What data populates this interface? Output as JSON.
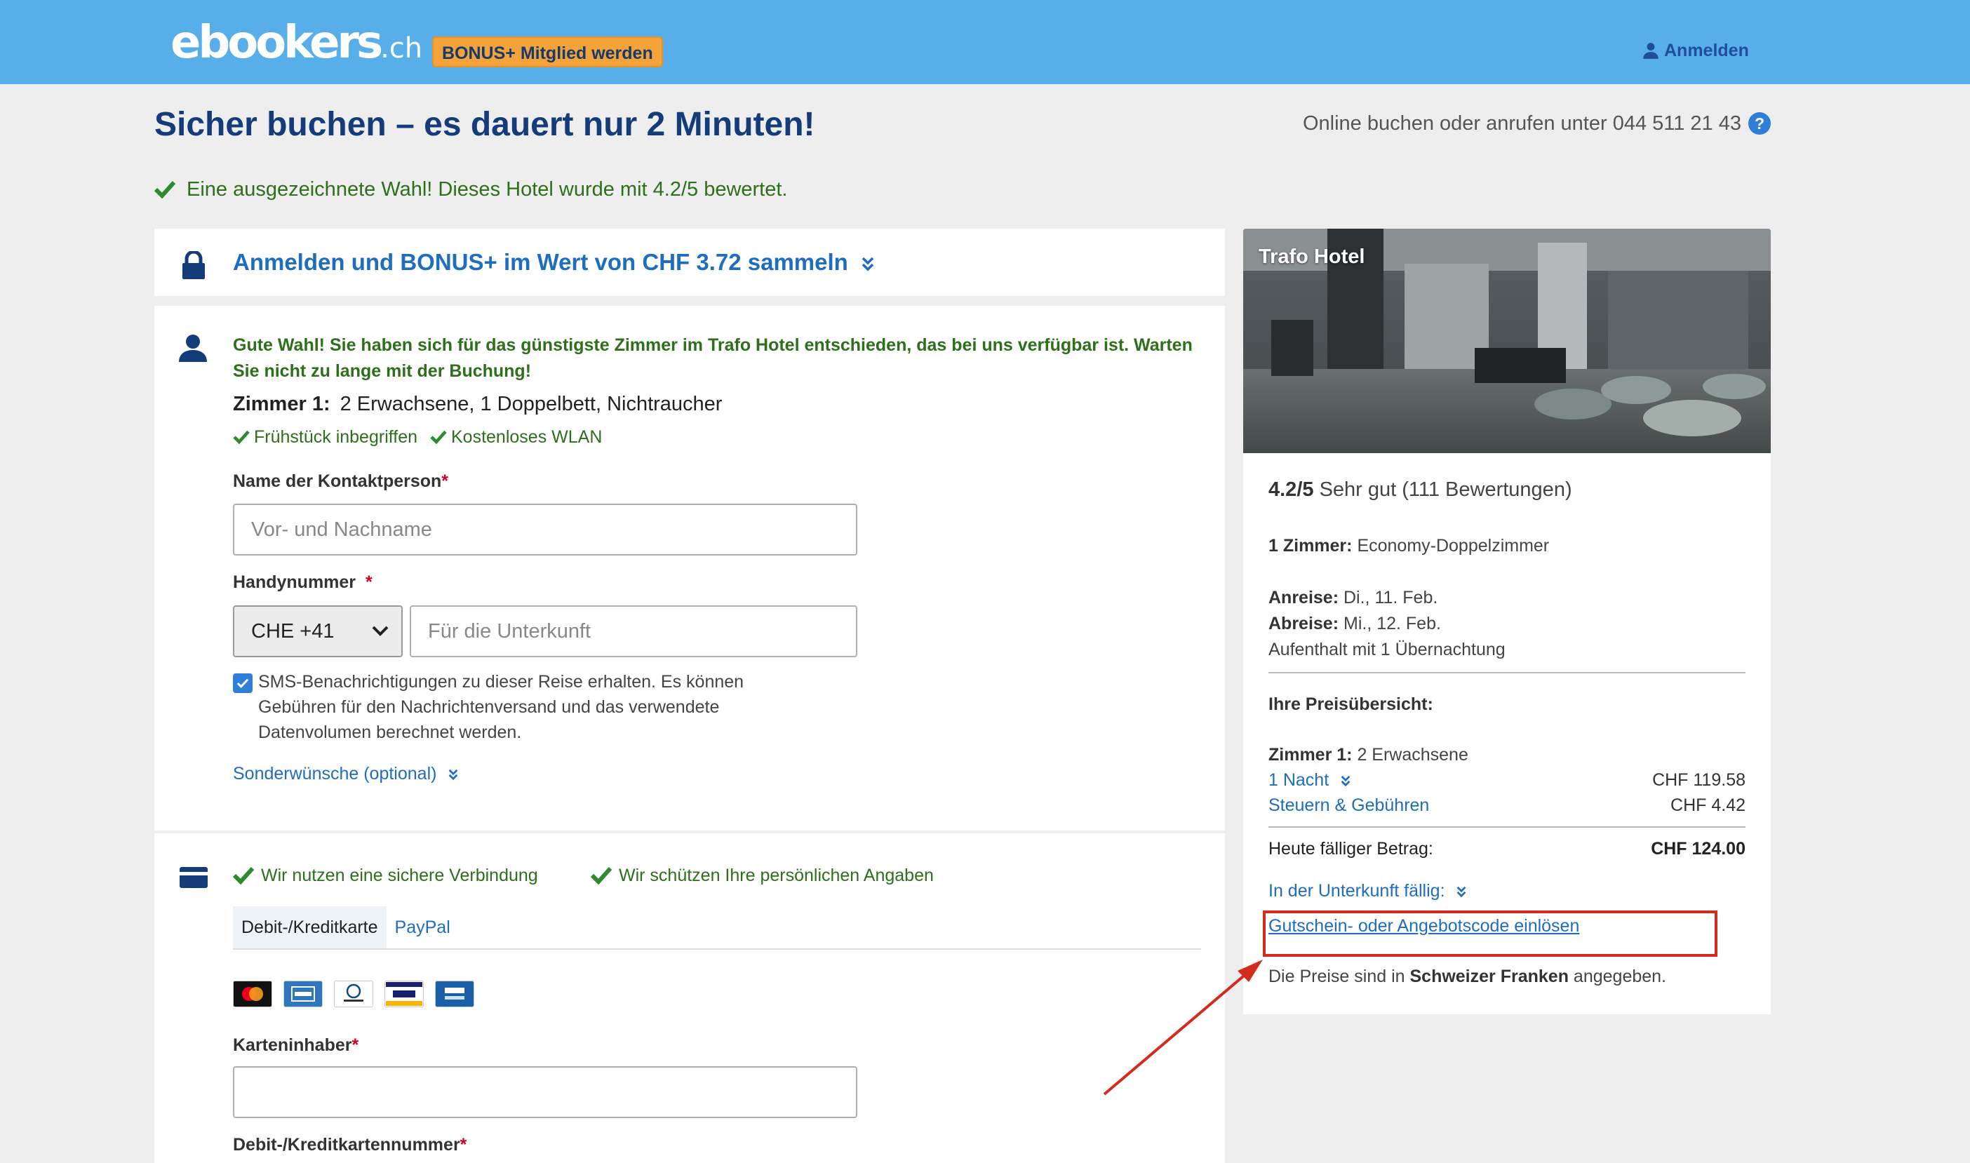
{
  "header": {
    "logo_main": "ebookers",
    "logo_suffix": ".ch",
    "bonus_button": "BONUS+ Mitglied werden",
    "login": "Anmelden"
  },
  "page": {
    "title": "Sicher buchen – es dauert nur 2 Minuten!",
    "phone_text": "Online buchen oder anrufen unter 044 511 21 43",
    "help_icon": "?",
    "rating_message": "Eine ausgezeichnete Wahl! Dieses Hotel wurde mit 4.2/5 bewertet."
  },
  "login_panel": {
    "title": "Anmelden und BONUS+ im Wert von CHF 3.72 sammeln"
  },
  "room_panel": {
    "good_choice": "Gute Wahl! Sie haben sich für das günstigste Zimmer im Trafo Hotel entschieden, das bei uns verfügbar ist. Warten Sie nicht zu lange mit der Buchung!",
    "room_label": "Zimmer 1:",
    "room_desc": "2 Erwachsene, 1 Doppelbett, Nichtraucher",
    "amenities": [
      "Frühstück inbegriffen",
      "Kostenloses WLAN"
    ],
    "contact_label": "Name der Kontaktperson",
    "contact_placeholder": "Vor- und Nachname",
    "phone_label": "Handynummer",
    "required_marker": "*",
    "country_code": "CHE +41",
    "phone_placeholder": "Für die Unterkunft",
    "sms_text": "SMS-Benachrichtigungen zu dieser Reise erhalten. Es können Gebühren für den Nachrichtenversand und das verwendete Datenvolumen berechnet werden.",
    "special_requests": "Sonderwünsche (optional)"
  },
  "payment_panel": {
    "secure_connection": "Wir nutzen eine sichere Verbindung",
    "protect_data": "Wir schützen Ihre persönlichen Angaben",
    "tabs": [
      "Debit-/Kreditkarte",
      "PayPal"
    ],
    "card_logos": [
      "mastercard",
      "amex",
      "diners-club",
      "visa",
      "visa-electron"
    ],
    "cardholder_label": "Karteninhaber",
    "card_number_label": "Debit-/Kreditkartennummer"
  },
  "sidebar": {
    "hotel_name": "Trafo Hotel",
    "rating_score": "4.2/5",
    "rating_text": "Sehr gut (111 Bewertungen)",
    "rooms_label": "1 Zimmer:",
    "room_type": "Economy-Doppelzimmer",
    "checkin_label": "Anreise:",
    "checkin_date": "Di., 11. Feb.",
    "checkout_label": "Abreise:",
    "checkout_date": "Mi., 12. Feb.",
    "stay": "Aufenthalt mit 1 Übernachtung",
    "price_overview": "Ihre Preisübersicht:",
    "room1_label": "Zimmer 1:",
    "room1_guests": "2 Erwachsene",
    "night_label": "1 Nacht",
    "night_price": "CHF 119.58",
    "taxes_label": "Steuern & Gebühren",
    "taxes_price": "CHF 4.42",
    "due_today_label": "Heute fälliger Betrag:",
    "due_today_price": "CHF 124.00",
    "due_at_property": "In der Unterkunft fällig:",
    "voucher_link": "Gutschein- oder Angebotscode einlösen",
    "currency_note_pre": "Die Preise sind in",
    "currency_note_bold": "Schweizer Franken",
    "currency_note_post": "angegeben."
  },
  "colors": {
    "header_bg": "#58aee9",
    "title_blue": "#143b7a",
    "link_blue": "#1f6dbf",
    "success_green": "#2e6f1b",
    "bonus_orange": "#f4a33a",
    "annotation_red": "#d32b1e"
  }
}
